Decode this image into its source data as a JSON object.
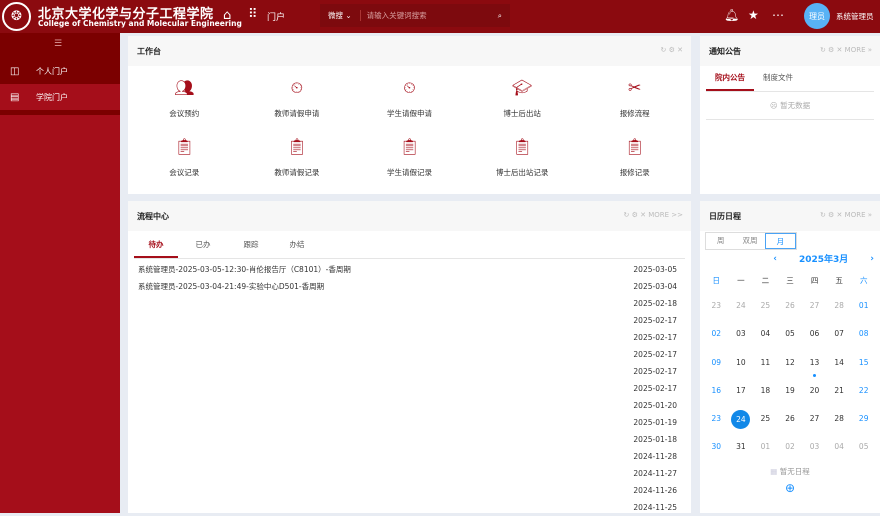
{
  "header": {
    "title_cn": "北京大学化学与分子工程学院",
    "title_en": "College of Chemistry and Molecular Engineering",
    "portal_label": "门户",
    "search_scope": "微搜",
    "search_placeholder": "请输入关键词搜索",
    "avatar_text": "理员",
    "username": "系统管理员"
  },
  "sidebar": {
    "items": [
      {
        "label": "个人门户",
        "icon": "layout-icon"
      },
      {
        "label": "学院门户",
        "icon": "window-icon"
      }
    ]
  },
  "workbench": {
    "title": "工作台",
    "items": [
      {
        "label": "会议预约",
        "icon": "meeting-icon"
      },
      {
        "label": "教师请假申请",
        "icon": "teacher-leave-icon"
      },
      {
        "label": "学生请假申请",
        "icon": "student-leave-icon"
      },
      {
        "label": "博士后出站",
        "icon": "graduation-cap-icon"
      },
      {
        "label": "报修流程",
        "icon": "tools-icon"
      },
      {
        "label": "会议记录",
        "icon": "record-icon"
      },
      {
        "label": "教师请假记录",
        "icon": "record-icon"
      },
      {
        "label": "学生请假记录",
        "icon": "record-icon"
      },
      {
        "label": "博士后出站记录",
        "icon": "record-icon"
      },
      {
        "label": "报修记录",
        "icon": "record-icon"
      }
    ]
  },
  "notice": {
    "title": "通知公告",
    "tabs": [
      "院内公告",
      "制度文件"
    ],
    "empty": "暂无数据"
  },
  "process": {
    "title": "流程中心",
    "more": "MORE >>",
    "tabs": [
      "待办",
      "已办",
      "跟踪",
      "办结"
    ],
    "rows": [
      {
        "title": "系统管理员-2025-03-05-12:30-肖伦报告厅（C8101）-香周期",
        "date": "2025-03-05"
      },
      {
        "title": "系统管理员-2025-03-04-21:49-实验中心D501-香周期",
        "date": "2025-03-04"
      },
      {
        "title": "",
        "date": "2025-02-18"
      },
      {
        "title": "",
        "date": "2025-02-17"
      },
      {
        "title": "",
        "date": "2025-02-17"
      },
      {
        "title": "",
        "date": "2025-02-17"
      },
      {
        "title": "",
        "date": "2025-02-17"
      },
      {
        "title": "",
        "date": "2025-02-17"
      },
      {
        "title": "",
        "date": "2025-01-20"
      },
      {
        "title": "",
        "date": "2025-01-19"
      },
      {
        "title": "",
        "date": "2025-01-18"
      },
      {
        "title": "",
        "date": "2024-11-28"
      },
      {
        "title": "",
        "date": "2024-11-27"
      },
      {
        "title": "",
        "date": "2024-11-26"
      },
      {
        "title": "",
        "date": "2024-11-25"
      }
    ]
  },
  "calendar": {
    "title": "日历日程",
    "views": [
      "周",
      "双周",
      "月"
    ],
    "active_view": "月",
    "month": "2025年3月",
    "weekdays": [
      "日",
      "一",
      "二",
      "三",
      "四",
      "五",
      "六"
    ],
    "days": [
      "23",
      "24",
      "25",
      "26",
      "27",
      "28",
      "01",
      "02",
      "03",
      "04",
      "05",
      "06",
      "07",
      "08",
      "09",
      "10",
      "11",
      "12",
      "13",
      "14",
      "15",
      "16",
      "17",
      "18",
      "19",
      "20",
      "21",
      "22",
      "23",
      "24",
      "25",
      "26",
      "27",
      "28",
      "29",
      "30",
      "31",
      "01",
      "02",
      "03",
      "04",
      "05"
    ],
    "selected": "24",
    "event_day": "13",
    "empty": "暂无日程"
  },
  "colors": {
    "brand": "#8b0a0f",
    "accent": "#1890ff"
  }
}
